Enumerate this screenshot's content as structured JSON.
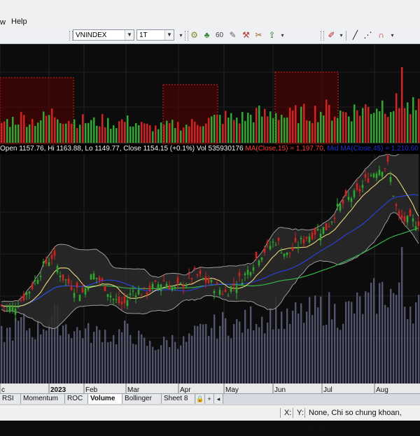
{
  "menu": {
    "fragment": "w",
    "help": "Help"
  },
  "toolbar": {
    "symbol": "VNINDEX",
    "period": "1T",
    "dropdown_glyph": "▼",
    "icons": [
      "pattern-icon",
      "signal-icon",
      "scan-icon",
      "draw-icon",
      "hammer-icon",
      "tool-icon",
      "export-icon"
    ],
    "draw_icons": [
      "pen-color-icon",
      "line-icon",
      "dash-line-icon",
      "magnet-icon"
    ]
  },
  "info_bar": {
    "quote": "Open 1157.76, Hi 1163.88, Lo 1149.77, Close 1154.15 (+0.1%) Vol 535930176",
    "ma15": "MA(Close,15) = 1,197.70,",
    "mid_ma": "Mid MA(Close,45) = 1,210.60"
  },
  "time_axis": {
    "labels": [
      "c",
      "2023",
      "Feb",
      "Mar",
      "Apr",
      "May",
      "Jun",
      "Jul",
      "Aug"
    ]
  },
  "tabs": [
    "RSI",
    "Momentum",
    "ROC",
    "Volume",
    "Bollinger",
    "Sheet 8"
  ],
  "active_tab": "Volume",
  "tab_controls": [
    "🔒",
    "+",
    "◂"
  ],
  "status": {
    "x": "X:",
    "y": "Y:",
    "info": "None, Chi so chung khoan, None, N"
  },
  "colors": {
    "up": "#2ea82e",
    "down": "#d42222",
    "ma15": "#e8d87a",
    "mid_ma": "#2a3fd8",
    "long_ma": "#37b54a",
    "band": "#a8a8a8",
    "band_fill": "#2b2b2b",
    "bg": "#0c0c0c",
    "volume_bar": "#5b5c78",
    "highlight_box": "#5a0000"
  },
  "chart_data": {
    "type": "candlestick",
    "symbol": "VNINDEX",
    "period": "1T",
    "x": [
      "c",
      "2023",
      "Feb",
      "Mar",
      "Apr",
      "May",
      "Jun",
      "Jul",
      "Aug"
    ],
    "series": [
      {
        "name": "MA(Close,15)",
        "last": 1197.7
      },
      {
        "name": "Mid MA(Close,45)",
        "last": 1210.6
      }
    ],
    "last_bar": {
      "open": 1157.76,
      "high": 1163.88,
      "low": 1149.77,
      "close": 1154.15,
      "change_pct": 0.1,
      "volume": 535930176
    },
    "close_path": [
      1020,
      1015,
      1030,
      1050,
      1080,
      1100,
      1065,
      1050,
      1040,
      1070,
      1055,
      1030,
      1020,
      1045,
      1040,
      1050,
      1060,
      1045,
      1055,
      1070,
      1060,
      1050,
      1040,
      1055,
      1070,
      1095,
      1110,
      1125,
      1100,
      1115,
      1130,
      1140,
      1145,
      1175,
      1190,
      1200,
      1225,
      1240,
      1245,
      1160,
      1155,
      1154.15
    ],
    "volume_relative": [
      0.45,
      0.5,
      0.6,
      0.5,
      0.55,
      0.7,
      0.6,
      0.5,
      0.5,
      0.45,
      0.5,
      0.4,
      0.5,
      0.45,
      0.35,
      0.3,
      0.35,
      0.4,
      0.35,
      0.45,
      0.5,
      0.55,
      0.6,
      0.55,
      0.6,
      0.7,
      0.65,
      0.75,
      0.6,
      0.7,
      0.7,
      0.75,
      0.8,
      0.7,
      0.75,
      0.8,
      0.85,
      0.95,
      1.0,
      0.9,
      0.85,
      0.8
    ]
  }
}
